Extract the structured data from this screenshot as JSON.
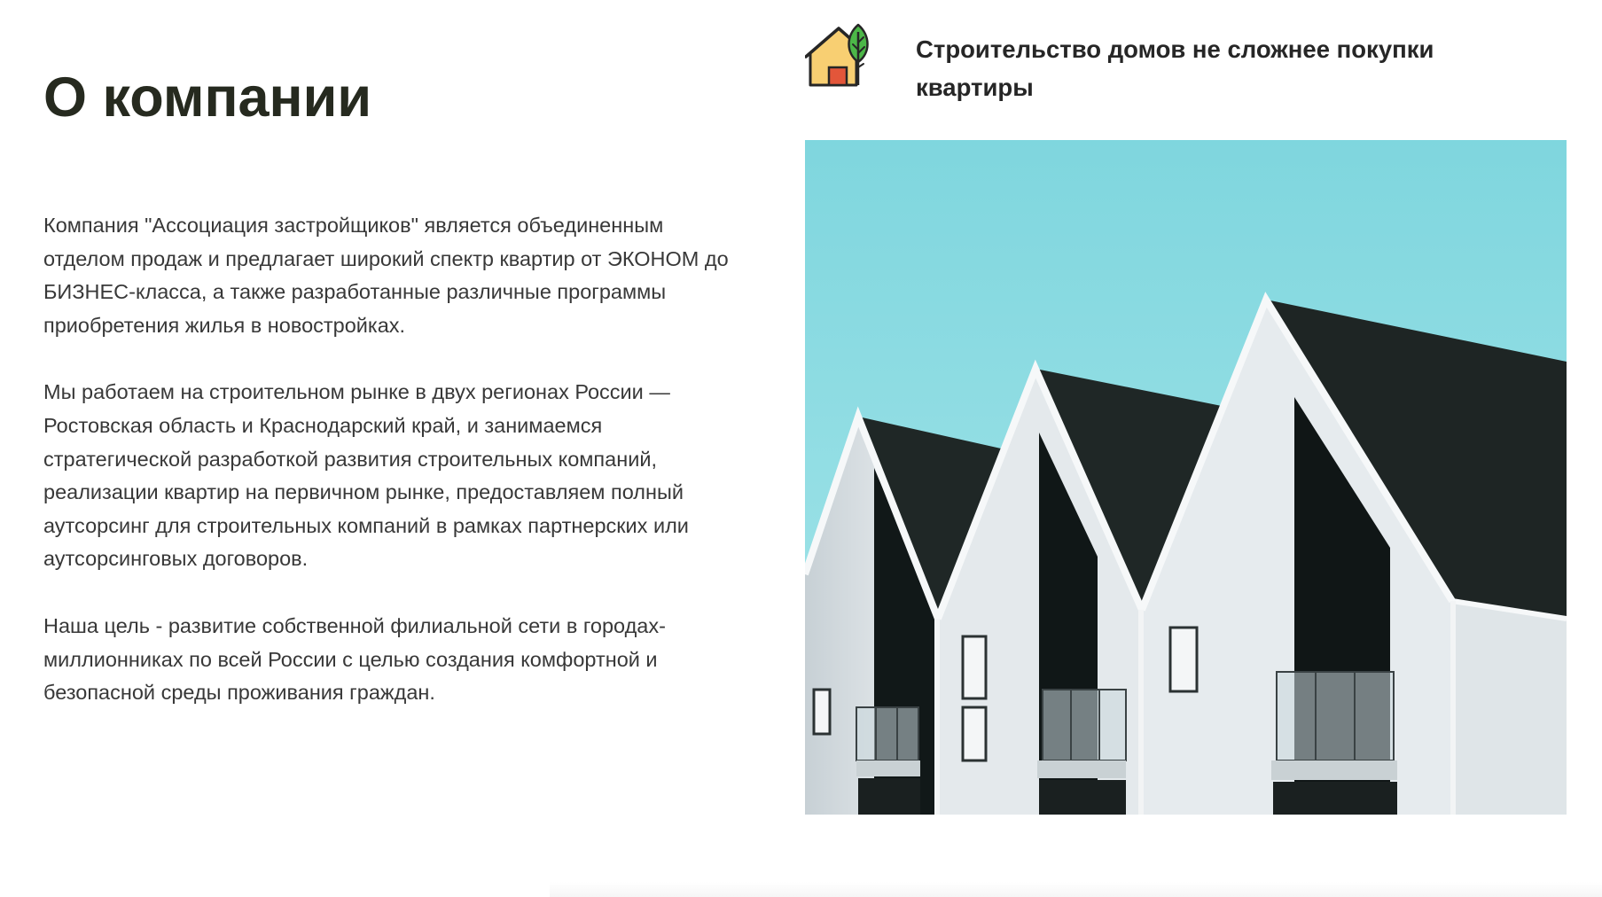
{
  "about": {
    "title": "О компании",
    "paragraphs": [
      "Компания \"Ассоциация застройщиков\" является объединенным отделом продаж и предлагает широкий спектр квартир от ЭКОНОМ до БИЗНЕС-класса, а также разработанные различные программы приобретения жилья в новостройках.",
      "Мы работаем на строительном рынке в двух регионах России — Ростовская область и Краснодарский край, и занимаемся стратегической разработкой развития строительных компаний, реализации квартир на первичном рынке, предоставляем полный аутсорсинг для строительных компаний в рамках партнерских или аутсорсинговых договоров.",
      "Наша цель - развитие собственной филиальной сети в городах-миллионниках по всей России с целью создания комфортной и безопасной среды проживания граждан."
    ]
  },
  "feature": {
    "icon": "eco-house-icon",
    "title": "Строительство домов не сложнее покупки квартиры"
  },
  "photo": {
    "subject": "gabled-houses-photo"
  },
  "colors": {
    "heading": "#262a1f",
    "text": "#383838",
    "sky": "#8fdce3",
    "roof": "#1e2524",
    "wall": "#e4e9ec"
  }
}
